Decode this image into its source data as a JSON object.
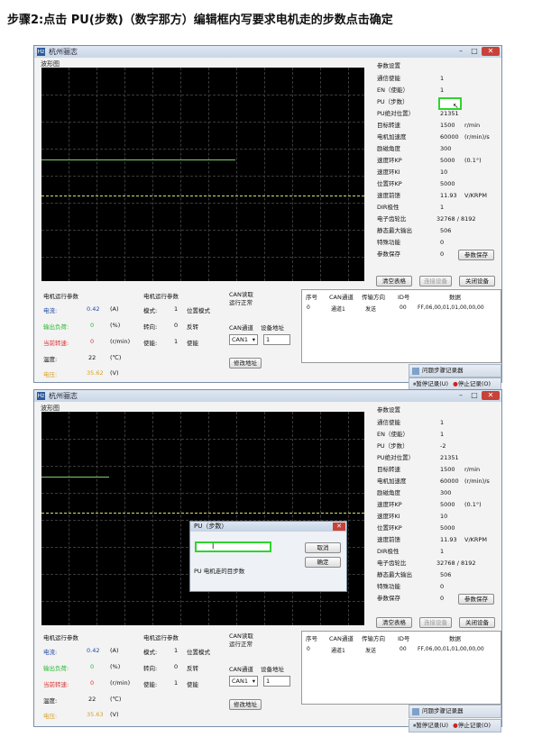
{
  "step_title": "步骤2:点击 PU(步数)（数字那方）编辑框内写要求电机走的步数点击确定",
  "app": {
    "title": "杭州骊志",
    "icon": "app-icon"
  },
  "graph": {
    "label": "波形图",
    "series_colors": [
      "#d8e06a",
      "#3fd44a"
    ]
  },
  "params": {
    "header": "参数设置",
    "rows": [
      {
        "name": "通信使能",
        "value": "1",
        "unit": ""
      },
      {
        "name": "EN（使能）",
        "value": "1",
        "unit": ""
      },
      {
        "name": "PU（步数）",
        "value": "",
        "unit": ""
      },
      {
        "name": "PU绝对位置）",
        "value": "21351",
        "unit": ""
      },
      {
        "name": "目标转速",
        "value": "1500",
        "unit": "r/min"
      },
      {
        "name": "电机加速度",
        "value": "60000",
        "unit": "(r/min)/s"
      },
      {
        "name": "励磁角度",
        "value": "300",
        "unit": ""
      },
      {
        "name": "速度环KP",
        "value": "5000",
        "unit": "(0.1°)"
      },
      {
        "name": "速度环KI",
        "value": "10",
        "unit": ""
      },
      {
        "name": "位置环KP",
        "value": "5000",
        "unit": ""
      },
      {
        "name": "速度前馈",
        "value": "11.93",
        "unit": "V/KRPM"
      },
      {
        "name": "DIR极性",
        "value": "1",
        "unit": ""
      },
      {
        "name": "电子齿轮比",
        "value": "32768 / 8192",
        "unit": ""
      },
      {
        "name": "静态最大输出",
        "value": "506",
        "unit": ""
      },
      {
        "name": "特殊功能",
        "value": "0",
        "unit": ""
      },
      {
        "name": "参数保存",
        "value": "0",
        "unit": ""
      }
    ],
    "pu_value_second": "-2",
    "save_button": "参数保存"
  },
  "buttons": {
    "clear_table": "清空表格",
    "connect": "连接设备",
    "close_device": "关闭设备",
    "modify_address": "修改地址"
  },
  "motor_status": {
    "header": "电机运行参数",
    "current_label": "电流:",
    "current_value": "0.42",
    "current_unit": "(A)",
    "output_label": "输出负荷:",
    "output_value": "0",
    "output_unit": "(%)",
    "speed_label": "当前转速:",
    "speed_value": "0",
    "speed_unit": "(r/min)",
    "temp_label": "温度:",
    "temp_value": "22",
    "temp_unit": "(℃)",
    "voltage_label": "电压:",
    "voltage_value": "35.62",
    "voltage_unit": "(V)",
    "voltage_value_second": "35.63"
  },
  "motor_state": {
    "header": "电机运行参数",
    "mode_label": "模式:",
    "mode_value": "1",
    "mode_text": "位置模式",
    "dir_label": "转向:",
    "dir_value": "0",
    "dir_text": "反转",
    "enable_label": "使能:",
    "enable_value": "1",
    "enable_text": "使能"
  },
  "can_panel": {
    "read_header": "CAN读取",
    "read_status": "运行正常",
    "channel_label": "CAN通道",
    "address_label": "设备地址",
    "channel_value": "CAN1",
    "address_value": "1"
  },
  "can_table": {
    "headers": [
      "序号",
      "CAN通道",
      "传输方向",
      "ID号",
      "数据"
    ],
    "rows": [
      [
        "0",
        "通道1",
        "发送",
        "00",
        "FF,06,00,01,01,00,00,00"
      ]
    ]
  },
  "taskbar": {
    "recorder_label": "问题步骤记录器",
    "pause_label": "暂停记录(U)",
    "stop_label": "停止记录(O)"
  },
  "dialog": {
    "title": "PU（步数）",
    "input_value": "",
    "cancel": "取消",
    "ok": "确定",
    "message": "PU 电机走的目步数"
  }
}
